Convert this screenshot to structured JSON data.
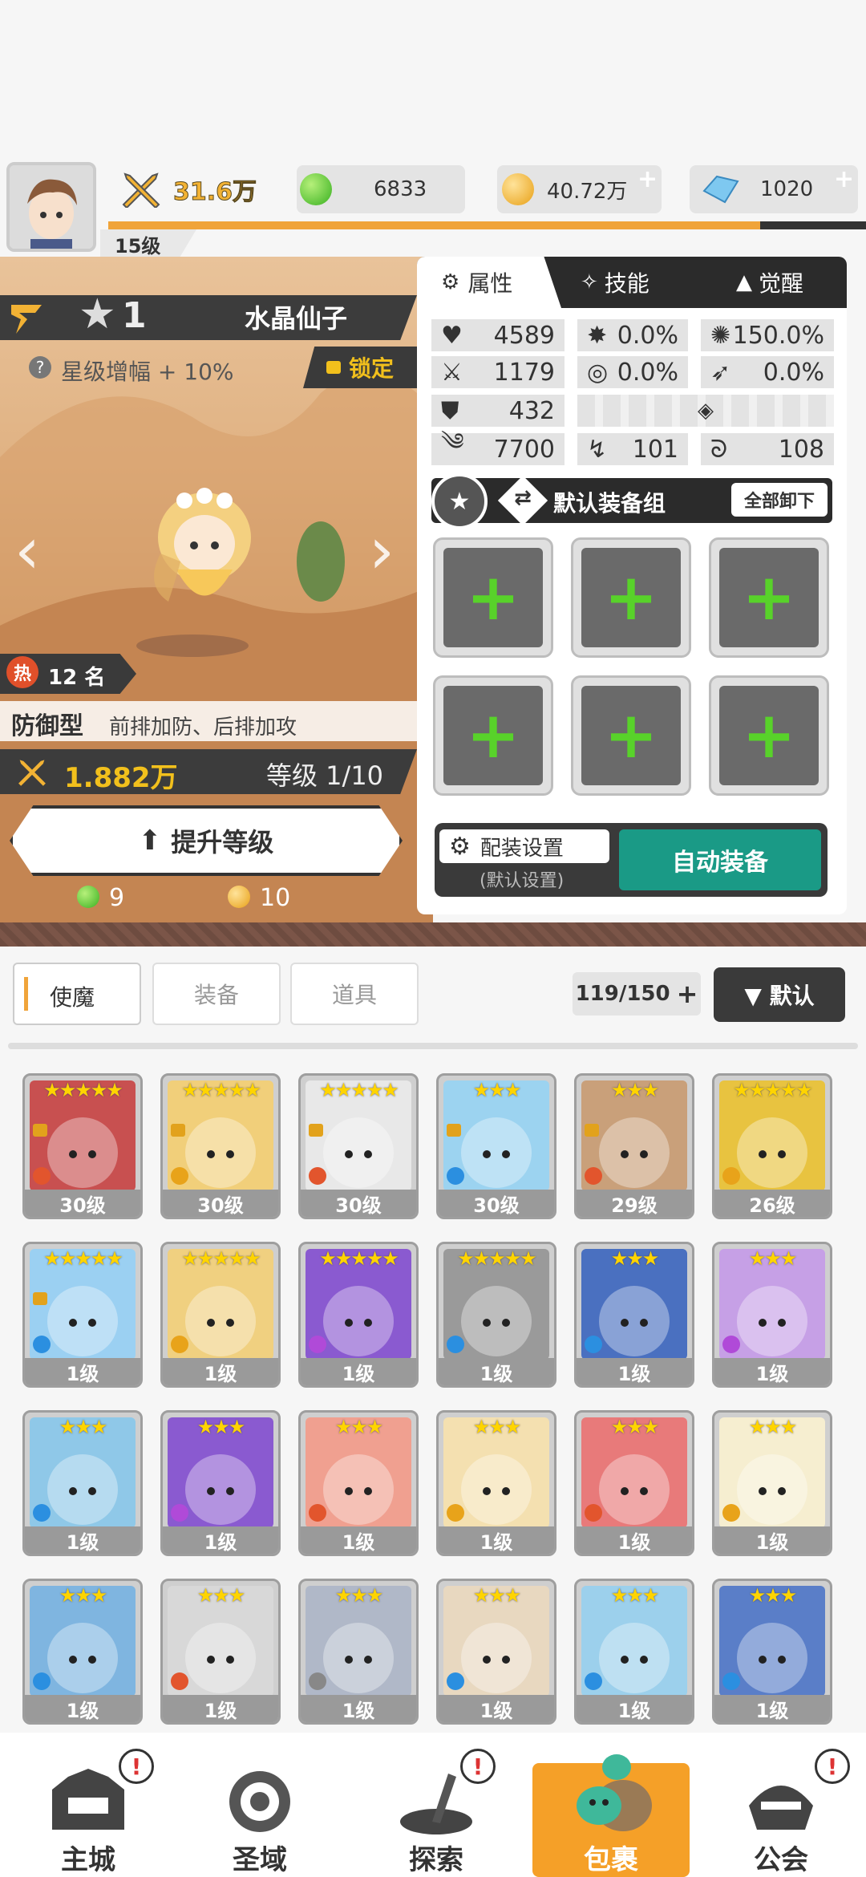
{
  "header": {
    "power": "31.6万",
    "green_currency": "6833",
    "gold_currency": "40.72万",
    "crystal_currency": "1020",
    "player_level": "15级",
    "xp_progress": 0.86
  },
  "hero": {
    "stars": "1",
    "name": "水晶仙子",
    "star_bonus": "星级增幅 + 10%",
    "lock_label": "锁定",
    "hot_rank": "12 名",
    "hot_label": "热",
    "role": "防御型",
    "role_desc": "前排加防、后排加攻",
    "power": "1.882万",
    "level": "等级 1/10",
    "upgrade_label": "提升等级",
    "cost_green": "9",
    "cost_gold": "10"
  },
  "panel": {
    "tabs": [
      "属性",
      "技能",
      "觉醒"
    ],
    "stats": [
      {
        "icon": "heart-icon",
        "value": "4589"
      },
      {
        "icon": "crit-icon",
        "value": "0.0%"
      },
      {
        "icon": "crit-dmg-icon",
        "value": "150.0%"
      },
      {
        "icon": "sword-icon",
        "value": "1179"
      },
      {
        "icon": "target-icon",
        "value": "0.0%"
      },
      {
        "icon": "dodge-icon",
        "value": "0.0%"
      },
      {
        "icon": "shield-icon",
        "value": "432"
      },
      {
        "icon": "speed-icon",
        "value": "7700"
      },
      {
        "icon": "pierce-icon",
        "value": "101"
      },
      {
        "icon": "resist-icon",
        "value": "108"
      }
    ],
    "equip_set_label": "默认装备组",
    "unequip_all": "全部卸下",
    "config_label": "配装设置",
    "config_sub": "(默认设置)",
    "auto_equip": "自动装备"
  },
  "inventory": {
    "tabs": [
      "使魔",
      "装备",
      "道具"
    ],
    "count": "119/150",
    "sort_label": "▼ 默认",
    "cards": [
      {
        "level": "30级",
        "stars": "★★★★★",
        "locked": true,
        "element": "#e2552d",
        "bg": "#c85050"
      },
      {
        "level": "30级",
        "stars": "★★★★★",
        "locked": true,
        "element": "#e8a31a",
        "bg": "#f1cf7a"
      },
      {
        "level": "30级",
        "stars": "★★★★★",
        "locked": true,
        "element": "#e2552d",
        "bg": "#e8e8e8"
      },
      {
        "level": "30级",
        "stars": "★★★",
        "locked": true,
        "element": "#2b8fe0",
        "bg": "#9cd3f0"
      },
      {
        "level": "29级",
        "stars": "★★★",
        "locked": true,
        "element": "#e2552d",
        "bg": "#c9a07a"
      },
      {
        "level": "26级",
        "stars": "★★★★★",
        "locked": false,
        "element": "#e8a31a",
        "bg": "#e8c340"
      },
      {
        "level": "1级",
        "stars": "★★★★★",
        "locked": true,
        "element": "#2b8fe0",
        "bg": "#9bd0f2"
      },
      {
        "level": "1级",
        "stars": "★★★★★",
        "locked": false,
        "element": "#e8a31a",
        "bg": "#f0d080"
      },
      {
        "level": "1级",
        "stars": "★★★★★",
        "locked": false,
        "element": "#b04ad8",
        "bg": "#8a5ad0"
      },
      {
        "level": "1级",
        "stars": "★★★★★",
        "locked": false,
        "element": "#2b8fe0",
        "bg": "#9a9a9a"
      },
      {
        "level": "1级",
        "stars": "★★★",
        "locked": false,
        "element": "#2b8fe0",
        "bg": "#4a70c0"
      },
      {
        "level": "1级",
        "stars": "★★★",
        "locked": false,
        "element": "#b04ad8",
        "bg": "#c6a0e6"
      },
      {
        "level": "1级",
        "stars": "★★★",
        "locked": false,
        "element": "#2b8fe0",
        "bg": "#8fc8e8"
      },
      {
        "level": "1级",
        "stars": "★★★",
        "locked": false,
        "element": "#b04ad8",
        "bg": "#8a5ad0"
      },
      {
        "level": "1级",
        "stars": "★★★",
        "locked": false,
        "element": "#e2552d",
        "bg": "#f0a090"
      },
      {
        "level": "1级",
        "stars": "★★★",
        "locked": false,
        "element": "#e8a31a",
        "bg": "#f4e0b0"
      },
      {
        "level": "1级",
        "stars": "★★★",
        "locked": false,
        "element": "#e2552d",
        "bg": "#e87a7a"
      },
      {
        "level": "1级",
        "stars": "★★★",
        "locked": false,
        "element": "#e8a31a",
        "bg": "#f6eed0"
      },
      {
        "level": "1级",
        "stars": "★★★",
        "locked": false,
        "element": "#2b8fe0",
        "bg": "#7fb5e0"
      },
      {
        "level": "1级",
        "stars": "★★★",
        "locked": false,
        "element": "#e2552d",
        "bg": "#d8d8d8"
      },
      {
        "level": "1级",
        "stars": "★★★",
        "locked": false,
        "element": "#888888",
        "bg": "#b0b8c8"
      },
      {
        "level": "1级",
        "stars": "★★★",
        "locked": false,
        "element": "#2b8fe0",
        "bg": "#e8d8c0"
      },
      {
        "level": "1级",
        "stars": "★★★",
        "locked": false,
        "element": "#2b8fe0",
        "bg": "#9cd0ec"
      },
      {
        "level": "1级",
        "stars": "★★★",
        "locked": false,
        "element": "#2b8fe0",
        "bg": "#5a7ec8"
      }
    ]
  },
  "nav": [
    "主城",
    "圣域",
    "探索",
    "包裹",
    "公会"
  ],
  "colors": {
    "accent": "#f0a43a",
    "auto_equip": "#1a9a86",
    "active_nav": "#f5a028",
    "plus_green": "#58d22a"
  }
}
